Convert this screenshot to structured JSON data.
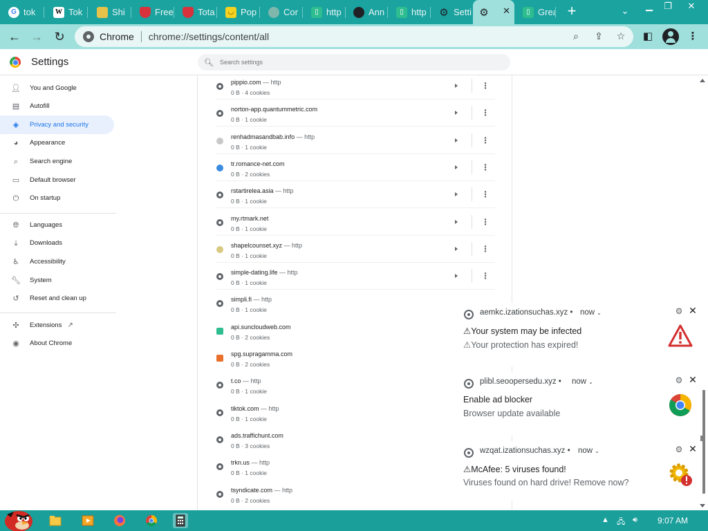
{
  "browser": {
    "tabs": [
      {
        "label": "tok",
        "icon": "google-icon"
      },
      {
        "label": "Tok",
        "icon": "wikipedia-icon"
      },
      {
        "label": "Shi",
        "icon": "bee-icon"
      },
      {
        "label": "Free",
        "icon": "shield-icon"
      },
      {
        "label": "Tota",
        "icon": "shield-icon"
      },
      {
        "label": "Pop",
        "icon": "smiley-icon"
      },
      {
        "label": "Cor",
        "icon": "circle-icon"
      },
      {
        "label": "http",
        "icon": "document-icon"
      },
      {
        "label": "Ann",
        "icon": "globe-icon"
      },
      {
        "label": "http",
        "icon": "document-icon"
      },
      {
        "label": "Setti",
        "icon": "gear-icon"
      },
      {
        "label": "S",
        "icon": "gear-icon",
        "active": true
      },
      {
        "label": "Grea",
        "icon": "document-icon"
      }
    ],
    "omnibox": {
      "site": "Chrome",
      "url": "chrome://settings/content/all"
    }
  },
  "settings": {
    "title": "Settings",
    "search_placeholder": "Search settings",
    "sidebar": [
      {
        "label": "You and Google",
        "icon": "person-icon"
      },
      {
        "label": "Autofill",
        "icon": "clipboard-icon"
      },
      {
        "label": "Privacy and security",
        "icon": "shield-icon",
        "active": true
      },
      {
        "label": "Appearance",
        "icon": "palette-icon"
      },
      {
        "label": "Search engine",
        "icon": "search-icon"
      },
      {
        "label": "Default browser",
        "icon": "browser-icon"
      },
      {
        "label": "On startup",
        "icon": "power-icon"
      },
      {
        "label": "Languages",
        "icon": "globe-icon"
      },
      {
        "label": "Downloads",
        "icon": "download-icon"
      },
      {
        "label": "Accessibility",
        "icon": "accessibility-icon"
      },
      {
        "label": "System",
        "icon": "wrench-icon"
      },
      {
        "label": "Reset and clean up",
        "icon": "history-icon"
      },
      {
        "label": "Extensions",
        "icon": "puzzle-icon"
      },
      {
        "label": "About Chrome",
        "icon": "chrome-icon"
      }
    ],
    "sites": [
      {
        "name": "pippio.com",
        "scheme": " — http",
        "meta": "0 B · 4 cookies",
        "icon": "globe-icon",
        "color": "#5f6368"
      },
      {
        "name": "norton-app.quantummetric.com",
        "scheme": "",
        "meta": "0 B · 1 cookie",
        "icon": "globe-icon",
        "color": "#5f6368"
      },
      {
        "name": "renhadmasandbab.info",
        "scheme": " — http",
        "meta": "0 B · 1 cookie",
        "icon": "moon-icon",
        "color": "#c8c8c8"
      },
      {
        "name": "tr.romance-net.com",
        "scheme": "",
        "meta": "0 B · 2 cookies",
        "icon": "heart-icon",
        "color": "#3b8be0"
      },
      {
        "name": "rstartirelea.asia",
        "scheme": " — http",
        "meta": "0 B · 1 cookie",
        "icon": "globe-icon",
        "color": "#5f6368"
      },
      {
        "name": "my.rtmark.net",
        "scheme": "",
        "meta": "0 B · 1 cookie",
        "icon": "globe-icon",
        "color": "#5f6368"
      },
      {
        "name": "shapelcounset.xyz",
        "scheme": " — http",
        "meta": "0 B · 1 cookie",
        "icon": "moon-icon",
        "color": "#d9c980"
      },
      {
        "name": "simple-dating.life",
        "scheme": " — http",
        "meta": "0 B · 1 cookie",
        "icon": "globe-icon",
        "color": "#5f6368"
      },
      {
        "name": "simpli.fi",
        "scheme": " — http",
        "meta": "0 B · 1 cookie",
        "icon": "globe-icon",
        "color": "#5f6368"
      },
      {
        "name": "api.suncloudweb.com",
        "scheme": "",
        "meta": "0 B · 2 cookies",
        "icon": "document-icon",
        "color": "#2dbd8f"
      },
      {
        "name": "spg.supragamma.com",
        "scheme": "",
        "meta": "0 B · 2 cookies",
        "icon": "s-badge-icon",
        "color": "#e8702a"
      },
      {
        "name": "t.co",
        "scheme": " — http",
        "meta": "0 B · 1 cookie",
        "icon": "globe-icon",
        "color": "#5f6368"
      },
      {
        "name": "tiktok.com",
        "scheme": " — http",
        "meta": "0 B · 1 cookie",
        "icon": "globe-icon",
        "color": "#5f6368"
      },
      {
        "name": "ads.traffichunt.com",
        "scheme": "",
        "meta": "0 B · 3 cookies",
        "icon": "globe-icon",
        "color": "#5f6368"
      },
      {
        "name": "trkn.us",
        "scheme": " — http",
        "meta": "0 B · 1 cookie",
        "icon": "globe-icon",
        "color": "#5f6368"
      },
      {
        "name": "tsyndicate.com",
        "scheme": " — http",
        "meta": "0 B · 2 cookies",
        "icon": "globe-icon",
        "color": "#5f6368"
      }
    ]
  },
  "notifications": [
    {
      "source": "aemkc.izationsuchas.xyz",
      "time": "now",
      "title": "⚠Your system may be infected",
      "body": "⚠Your protection has expired!",
      "image": "warning-triangle-icon"
    },
    {
      "source": "plibl.seoopersedu.xyz",
      "time": "now",
      "title": "Enable ad blocker",
      "body": "Browser update available",
      "image": "chrome-icon"
    },
    {
      "source": "wzqat.izationsuchas.xyz",
      "time": "now",
      "title": "⚠McAfee: 5 viruses found!",
      "body": "Viruses found on hard drive! Remove now?",
      "image": "gear-warning-icon"
    }
  ],
  "taskbar": {
    "clock": "9:07 AM"
  },
  "colors": {
    "tabstrip": "#1ba3a0",
    "toolbar": "#9fe0dc",
    "accent": "#1a73e8",
    "taskbar": "#1a9f9b"
  }
}
